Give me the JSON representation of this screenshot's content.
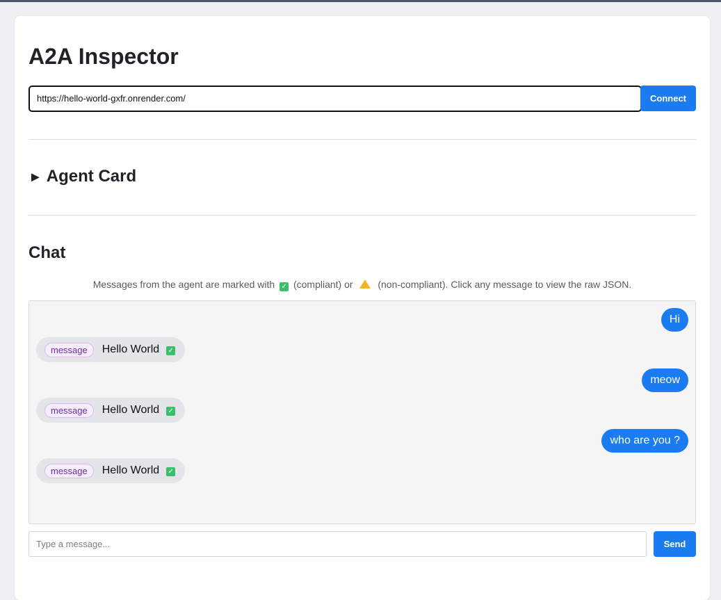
{
  "app": {
    "title": "A2A Inspector"
  },
  "connection": {
    "url_value": "https://hello-world-gxfr.onrender.com/",
    "connect_label": "Connect"
  },
  "agent_card": {
    "heading": "Agent Card",
    "toggle_glyph": "►"
  },
  "chat": {
    "heading": "Chat",
    "hint_prefix": "Messages from the agent are marked with",
    "hint_compliant": "(compliant) or",
    "hint_noncompliant": "(non-compliant). Click any message to view the raw JSON.",
    "messages": [
      {
        "role": "user",
        "text": "Hi"
      },
      {
        "role": "agent",
        "kind": "message",
        "text": "Hello World",
        "status": "compliant"
      },
      {
        "role": "user",
        "text": "meow"
      },
      {
        "role": "agent",
        "kind": "message",
        "text": "Hello World",
        "status": "compliant"
      },
      {
        "role": "user",
        "text": "who are you ?"
      },
      {
        "role": "agent",
        "kind": "message",
        "text": "Hello World",
        "status": "compliant"
      }
    ],
    "input_placeholder": "Type a message...",
    "send_label": "Send"
  },
  "colors": {
    "accent": "#1a7cf0",
    "compliant": "#3cbf6a",
    "warning": "#f5b321",
    "tag_text": "#6b2aa8"
  },
  "icons": {
    "compliant": "check-mark-icon",
    "noncompliant": "warning-icon",
    "collapse": "triangle-right-icon"
  }
}
